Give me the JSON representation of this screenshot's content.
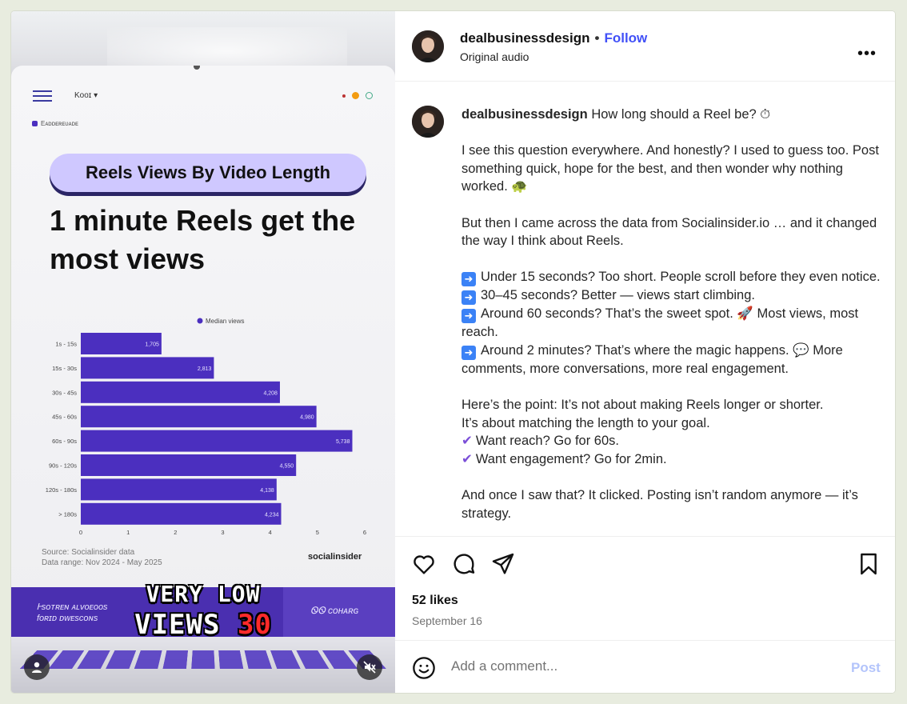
{
  "post": {
    "username": "dealbusinessdesign",
    "follow_label": "Follow",
    "audio": "Original audio",
    "more_label": "•••",
    "likes": "52 likes",
    "date": "September 16"
  },
  "caption": {
    "username": "dealbusinessdesign",
    "lines": {
      "l1": "How long should a Reel be? ⏱",
      "p1": "I see this question everywhere. And honestly? I used to guess too. Post something quick, hope for the best, and then wonder why nothing worked. 🐢",
      "p2": "But then I came across the data from Socialinsider.io … and it changed the way I think about Reels.",
      "b1": "Under 15 seconds? Too short. People scroll before they even notice.",
      "b2": "30–45 seconds? Better — views start climbing.",
      "b3": "Around 60 seconds? That’s the sweet spot. 🚀 Most views, most reach.",
      "b4": "Around 2 minutes? That’s where the magic happens. 💬 More comments, more conversations, more real engagement.",
      "p3a": "Here’s the point: It’s not about making Reels longer or shorter.",
      "p3b": "It’s about matching the length to your goal.",
      "c1": "Want reach? Go for 60s.",
      "c2": "Want engagement? Go for 2min.",
      "p4": "And once I saw that? It clicked. Posting isn’t random anymore — it’s strategy."
    }
  },
  "comment": {
    "placeholder": "Add a comment...",
    "post_label": "Post"
  },
  "media": {
    "tab_title": "Kᴏᴏɪ ▾",
    "tab_sub": "Eᴀᴅᴅᴇʀᴇᴜᴀᴅᴇ",
    "pill_title": "Reels Views By Video Length",
    "headline": "1 minute Reels get the most views",
    "source_line1": "Source: Socialinsider data",
    "source_line2": "Data range: Nov 2024 - May 2025",
    "brand": "socialinsider",
    "banner_left1": "Ꮀsᴏᴛʀᴇɴ ᴀʟᴠᴏᴇᴏᴏs",
    "banner_left2": "fᴏʀɪᴅ ᴅᴡᴇsᴄᴏɴs",
    "banner_right": "ᏫᏫ ᴄᴏʜᴀʀɢ",
    "overlay_line1": "VERY LOW",
    "overlay_line2a": "VIEWS ",
    "overlay_line2b": "30"
  },
  "colors": {
    "bar": "#4b2fbf",
    "follow": "#4150f7",
    "post_disabled": "#b3c4fb"
  },
  "chart_data": {
    "type": "bar",
    "orientation": "horizontal",
    "legend": [
      "Median views"
    ],
    "categories": [
      "1s - 15s",
      "15s - 30s",
      "30s - 45s",
      "45s - 60s",
      "60s - 90s",
      "90s - 120s",
      "120s - 180s",
      "> 180s"
    ],
    "values": [
      1705,
      2813,
      4208,
      4980,
      5738,
      4550,
      4138,
      4234
    ],
    "value_labels": [
      "1,705",
      "2,813",
      "4,208",
      "4,980",
      "5,738",
      "4,550",
      "4,138",
      "4,234"
    ],
    "xticks": [
      "0",
      "1",
      "2",
      "3",
      "4",
      "5",
      "6"
    ],
    "xlim": [
      0,
      6000
    ]
  }
}
